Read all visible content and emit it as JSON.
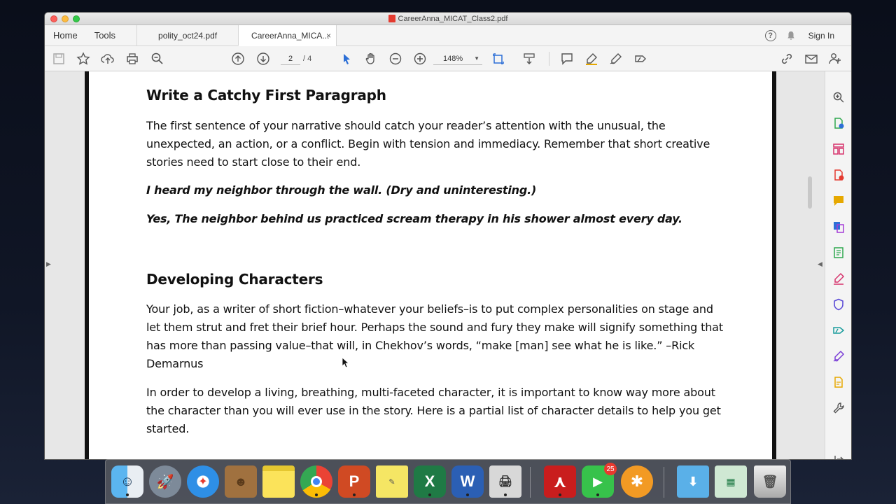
{
  "window": {
    "title": "CareerAnna_MICAT_Class2.pdf"
  },
  "tabrow": {
    "home": "Home",
    "tools": "Tools",
    "tabs": [
      {
        "label": "polity_oct24.pdf"
      },
      {
        "label": "CareerAnna_MICA..."
      }
    ],
    "close_glyph": "×",
    "help_glyph": "?",
    "signin": "Sign In"
  },
  "toolbar": {
    "page_current": "2",
    "page_total": "/ 4",
    "zoom": "148%"
  },
  "document": {
    "heading1": "Write a Catchy First Paragraph",
    "para1": "The first sentence of your narrative should catch your reader’s attention with the unusual, the unexpected, an action, or a conflict. Begin with tension and immediacy. Remember that short creative stories need to start close to their end.",
    "example1": "I heard my neighbor through the wall. (Dry and uninteresting.)",
    "example2": "Yes, The neighbor behind us practiced scream therapy in his shower almost every day.",
    "heading2": "Developing Characters",
    "para2": "Your job, as a writer of short fiction–whatever your beliefs–is to put complex personalities on stage and let them strut and fret their brief hour. Perhaps the sound and fury they make will signify something that has more than passing value–that will, in Chekhov’s words, “make [man] see what he is like.” –Rick Demarnus",
    "para3": "In order to develop a living, breathing, multi-faceted character, it is important to know way more about the character than you will ever use in the story. Here is a partial list of character details to help you get started."
  },
  "dock": {
    "facetime_badge": "25"
  },
  "colors": {
    "acrobat_red": "#e43a2f",
    "tool_blue": "#2c6fd6",
    "tool_green": "#2fa84f",
    "tool_pink": "#d6336c",
    "tool_yellow": "#e6a800"
  }
}
